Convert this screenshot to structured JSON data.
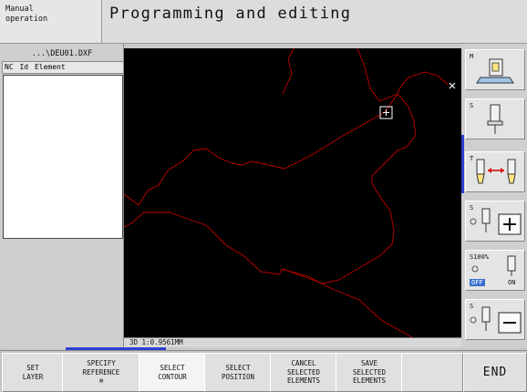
{
  "header": {
    "mode": "Manual\noperation",
    "title": "Programming and editing"
  },
  "left_panel": {
    "file_name": "...\\DEU01.DXF",
    "columns": [
      "NC",
      "Id",
      "Element"
    ]
  },
  "canvas": {
    "status": "3D  1:0.9561MM",
    "contour_color": "#c00000"
  },
  "right_softkeys": [
    {
      "label": "M",
      "icon": "tool-table-icon"
    },
    {
      "label": "S",
      "icon": "spindle-icon"
    },
    {
      "label": "T",
      "icon": "tool-change-icon"
    },
    {
      "label": "S",
      "icon": "spindle-plus-icon"
    },
    {
      "label": "S100%",
      "off": "OFF",
      "on": "ON",
      "icon": "spindle-override-icon"
    },
    {
      "label": "S",
      "icon": "spindle-minus-icon"
    }
  ],
  "bottom_softkeys": [
    {
      "label": "SET\nLAYER"
    },
    {
      "label": "SPECIFY\nREFERENCE\n⊕"
    },
    {
      "label": "SELECT\nCONTOUR"
    },
    {
      "label": "SELECT\nPOSITION"
    },
    {
      "label": "CANCEL\nSELECTED\nELEMENTS"
    },
    {
      "label": "SAVE\nSELECTED\nELEMENTS"
    },
    {
      "label": ""
    },
    {
      "label": "END"
    }
  ],
  "colors": {
    "accent": "#2e3fd0",
    "contour": "#c00000"
  }
}
